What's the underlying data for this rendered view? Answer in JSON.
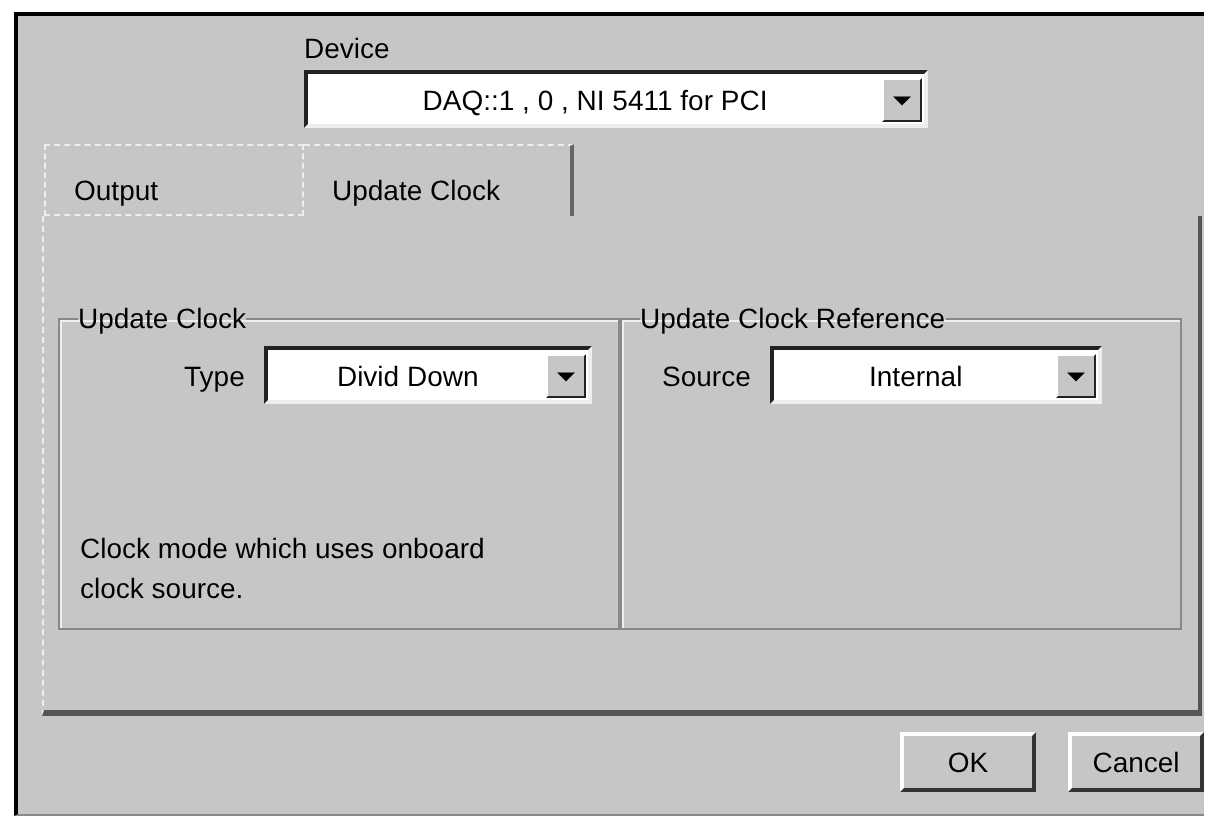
{
  "device": {
    "label": "Device",
    "value": "DAQ::1 , 0 , NI 5411 for PCI"
  },
  "tabs": [
    {
      "label": "Output",
      "selected": false
    },
    {
      "label": "Update Clock",
      "selected": true
    }
  ],
  "groups": [
    {
      "title": "Update Clock",
      "field_label": "Type",
      "value": "Divid Down",
      "description": "Clock mode which uses onboard clock source."
    },
    {
      "title": "Update Clock Reference",
      "field_label": "Source",
      "value": "Internal"
    }
  ],
  "buttons": [
    "OK",
    "Cancel"
  ]
}
